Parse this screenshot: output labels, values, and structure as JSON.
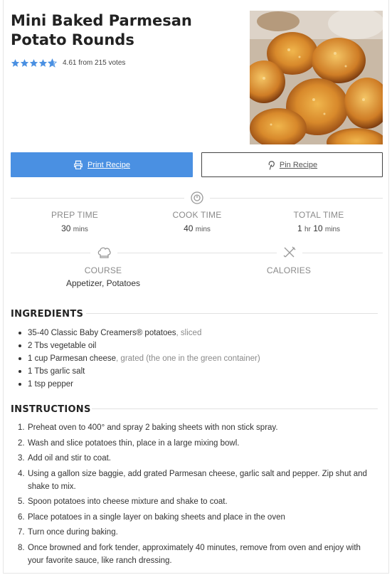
{
  "recipe": {
    "title": "Mini Baked Parmesan Potato Rounds",
    "rating_value": 4.61,
    "rating_text": "4.61 from 215 votes",
    "star_color": "#4a90e2"
  },
  "buttons": {
    "print_label": "Print Recipe",
    "pin_label": "Pin Recipe",
    "print_color": "#4a90e2"
  },
  "meta": {
    "prep_label": "PREP TIME",
    "prep_num": "30",
    "prep_unit": "mins",
    "cook_label": "COOK TIME",
    "cook_num": "40",
    "cook_unit": "mins",
    "total_label": "TOTAL TIME",
    "total_num1": "1",
    "total_unit1": "hr",
    "total_num2": "10",
    "total_unit2": "mins",
    "course_label": "COURSE",
    "course_value": "Appetizer, Potatoes",
    "calories_label": "CALORIES"
  },
  "ingredients": {
    "heading": "INGREDIENTS",
    "items": [
      {
        "main": "35-40 Classic Baby Creamers® potatoes",
        "note": ", sliced"
      },
      {
        "main": "2 Tbs vegetable oil",
        "note": ""
      },
      {
        "main": "1 cup Parmesan cheese",
        "note": ", grated (the one in the green container)"
      },
      {
        "main": "1 Tbs garlic salt",
        "note": ""
      },
      {
        "main": "1 tsp pepper",
        "note": ""
      }
    ]
  },
  "instructions": {
    "heading": "INSTRUCTIONS",
    "steps": [
      "Preheat oven to 400° and spray 2 baking sheets with non stick spray.",
      "Wash and slice potatoes thin, place in a large mixing bowl.",
      "Add oil and stir to coat.",
      "Using a gallon size baggie, add grated Parmesan cheese, garlic salt and pepper. Zip shut and shake to mix.",
      "Spoon potatoes into cheese mixture and shake to coat.",
      "Place potatoes in a single layer on baking sheets and place in the oven",
      "Turn once during baking.",
      "Once browned and fork tender, approximately 40 minutes, remove from oven and enjoy with your favorite sauce, like ranch dressing."
    ]
  },
  "icons": {
    "print": "printer-icon",
    "pin": "pinterest-icon",
    "timer": "timer-icon",
    "course": "chef-hat-icon",
    "calories": "fork-knife-icon"
  }
}
